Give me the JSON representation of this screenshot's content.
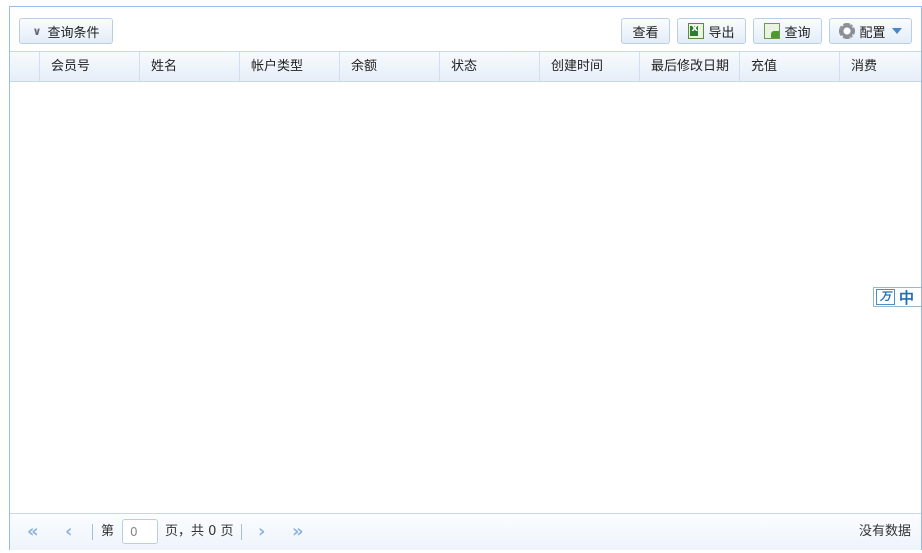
{
  "toolbar": {
    "filter_label": "查询条件",
    "view_label": "查看",
    "export_label": "导出",
    "query_label": "查询",
    "config_label": "配置"
  },
  "grid": {
    "columns": [
      "会员号",
      "姓名",
      "帐户类型",
      "余额",
      "状态",
      "创建时间",
      "最后修改日期",
      "充值",
      "消费"
    ]
  },
  "ime": {
    "mode": "中"
  },
  "pager": {
    "page_prefix": "第",
    "page_value": "0",
    "page_suffix": "页，共 0 页",
    "status": "没有数据"
  }
}
